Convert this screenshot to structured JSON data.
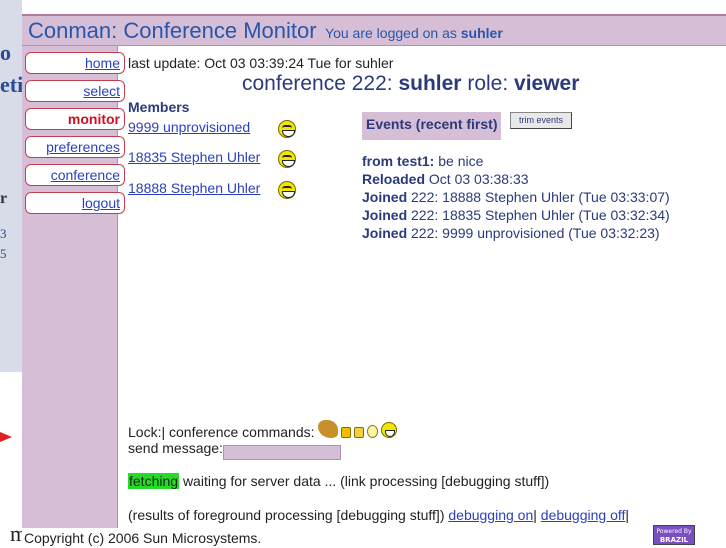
{
  "background": {
    "fragments": [
      "o",
      "eti",
      "r",
      "3",
      "5"
    ],
    "bottom_fragment": "m"
  },
  "title": {
    "app": "Conman: Conference Monitor",
    "logged_on_text": "You are logged on as",
    "username": "suhler"
  },
  "nav": [
    {
      "label": "home",
      "active": false
    },
    {
      "label": "select",
      "active": false
    },
    {
      "label": "monitor",
      "active": true
    },
    {
      "label": "preferences",
      "active": false
    },
    {
      "label": "conference",
      "active": false
    },
    {
      "label": "logout",
      "active": false
    }
  ],
  "status": {
    "last_update": "last update: Oct 03 03:39:24 Tue for suhler"
  },
  "conference": {
    "prefix": "conference 222:",
    "user": "suhler",
    "role_label": "role:",
    "role": "viewer"
  },
  "members": {
    "heading": "Members",
    "items": [
      {
        "label": "9999 unprovisioned",
        "icon": "smiley-icon"
      },
      {
        "label": "18835 Stephen Uhler",
        "icon": "smiley-icon"
      },
      {
        "label": "18888 Stephen Uhler",
        "icon": "smiley-icon"
      }
    ]
  },
  "events": {
    "heading": "Events (recent first)",
    "trim_label": "trim events",
    "items": [
      {
        "lead": "from test1:",
        "text": "be nice"
      },
      {
        "lead": "Reloaded",
        "text": "Oct 03 03:38:33"
      },
      {
        "lead": "Joined",
        "text": "222: 18888 Stephen Uhler (Tue 03:33:07)"
      },
      {
        "lead": "Joined",
        "text": "222: 18835 Stephen Uhler (Tue 03:32:34)"
      },
      {
        "lead": "Joined",
        "text": "222: 9999 unprovisioned (Tue 03:32:23)"
      }
    ]
  },
  "commands": {
    "lock_label": "Lock:|",
    "conf_label": "conference commands:",
    "icons": [
      "dragon-icon",
      "lock-icon",
      "unlock-icon",
      "lightbulb-icon",
      "laugh-icon"
    ]
  },
  "send": {
    "label": "send message:",
    "value": ""
  },
  "fetch": {
    "badge": "fetching",
    "text": "waiting for server data ... (link processing [debugging stuff])"
  },
  "results": {
    "text": "(results of foreground processing [debugging stuff])",
    "debug_on": "debugging on",
    "separator": "|",
    "debug_off": "debugging off",
    "trailing": "|"
  },
  "footer": {
    "copyright": "Copyright (c) 2006 Sun Microsystems.",
    "powered_line1": "Powered By",
    "powered_line2": "BRAZIL"
  },
  "colors": {
    "frame_purple": "#d6bfd6",
    "link_blue": "#2a3fc0",
    "active_red": "#d01020",
    "fetching_green": "#22dd22"
  }
}
